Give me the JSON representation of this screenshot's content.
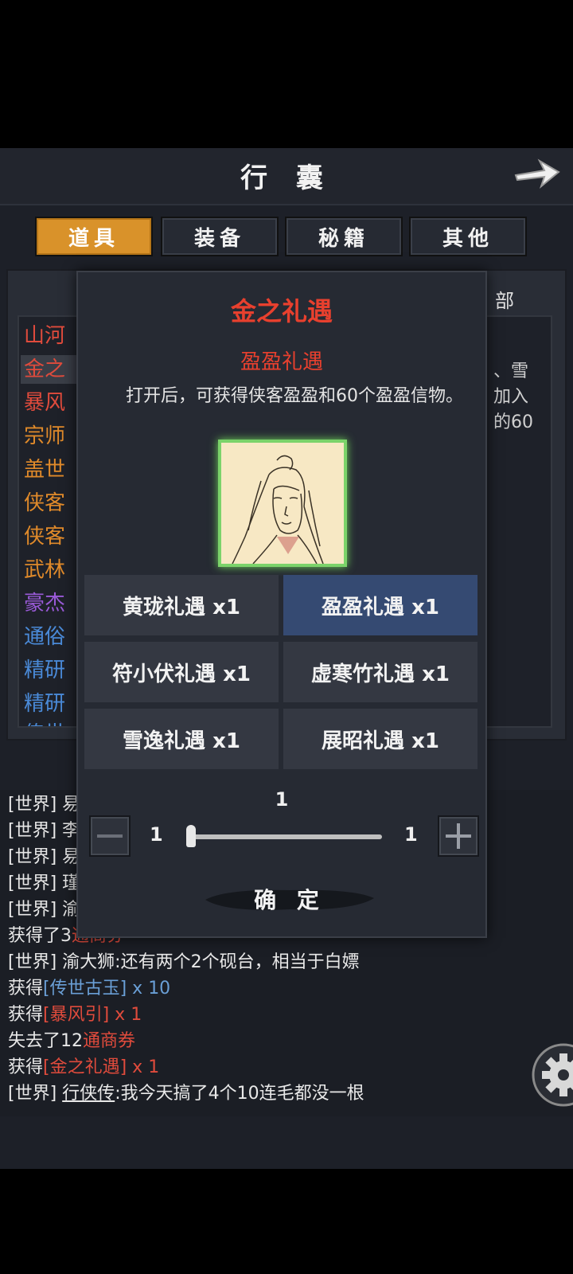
{
  "header": {
    "title": "行 囊"
  },
  "tabs": [
    {
      "label": "道具",
      "active": true
    },
    {
      "label": "装备",
      "active": false
    },
    {
      "label": "秘籍",
      "active": false
    },
    {
      "label": "其他",
      "active": false
    }
  ],
  "item_list": {
    "items": [
      {
        "label": "山河",
        "color": "#e04b3c"
      },
      {
        "label": "金之",
        "color": "#e04b3c",
        "selected": true
      },
      {
        "label": "暴风",
        "color": "#e04b3c"
      },
      {
        "label": "宗师",
        "color": "#e08a2a"
      },
      {
        "label": "盖世",
        "color": "#e08a2a"
      },
      {
        "label": "侠客",
        "color": "#e08a2a"
      },
      {
        "label": "侠客",
        "color": "#e08a2a"
      },
      {
        "label": "武林",
        "color": "#e08a2a"
      },
      {
        "label": "豪杰",
        "color": "#9a5ad8"
      },
      {
        "label": "通俗",
        "color": "#4a8ad8"
      },
      {
        "label": "精研",
        "color": "#4a8ad8"
      },
      {
        "label": "精研",
        "color": "#4a8ad8"
      },
      {
        "label": "传世",
        "color": "#4a8ad8"
      }
    ],
    "right_header": "部",
    "right_desc": [
      "、雪",
      "加入",
      "的60"
    ]
  },
  "chat": [
    {
      "parts": [
        {
          "t": "[世界] 易"
        }
      ]
    },
    {
      "parts": [
        {
          "t": "[世界] 李"
        }
      ]
    },
    {
      "parts": [
        {
          "t": "[世界] 易"
        }
      ]
    },
    {
      "parts": [
        {
          "t": "[世界] 瑾"
        }
      ]
    },
    {
      "parts": [
        {
          "t": "[世界] 渝"
        }
      ]
    },
    {
      "parts": [
        {
          "t": "获得了3"
        },
        {
          "t": "通商券",
          "c": "c-red"
        }
      ]
    },
    {
      "parts": [
        {
          "t": "[世界] 渝大狮:还有两个2个砚台，相当于白嫖"
        }
      ]
    },
    {
      "parts": [
        {
          "t": "获得"
        },
        {
          "t": "[传世古玉] x 10",
          "c": "c-blue"
        }
      ]
    },
    {
      "parts": [
        {
          "t": "获得"
        },
        {
          "t": "[暴风引] x 1",
          "c": "c-red"
        }
      ]
    },
    {
      "parts": [
        {
          "t": "失去了12"
        },
        {
          "t": "通商券",
          "c": "c-red"
        }
      ]
    },
    {
      "parts": [
        {
          "t": "获得"
        },
        {
          "t": "[金之礼遇] x 1",
          "c": "c-red"
        }
      ]
    },
    {
      "parts": [
        {
          "t": "[世界] "
        },
        {
          "t": "行侠传",
          "c": "c-under"
        },
        {
          "t": ":我今天搞了4个10连毛都没一根"
        }
      ]
    }
  ],
  "modal": {
    "title": "金之礼遇",
    "subtitle": "盈盈礼遇",
    "description": "打开后，可获得侠客盈盈和60个盈盈信物。",
    "options": [
      {
        "label": "黄珑礼遇 x1",
        "selected": false
      },
      {
        "label": "盈盈礼遇 x1",
        "selected": true
      },
      {
        "label": "符小伏礼遇 x1",
        "selected": false
      },
      {
        "label": "虚寒竹礼遇 x1",
        "selected": false
      },
      {
        "label": "雪逸礼遇 x1",
        "selected": false
      },
      {
        "label": "展昭礼遇 x1",
        "selected": false
      }
    ],
    "quantity": {
      "current": "1",
      "min": "1",
      "max": "1"
    },
    "confirm_label": "确 定"
  },
  "icons": {
    "back": "arrow-right-icon",
    "settings": "gear-icon",
    "minus": "minus-icon",
    "plus": "plus-icon"
  }
}
